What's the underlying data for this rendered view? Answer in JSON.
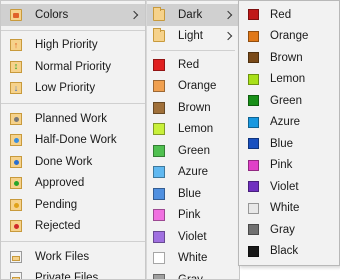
{
  "menu1": {
    "colors_label": "Colors",
    "priorities": [
      {
        "label": "High Priority",
        "icon": "high-priority-icon",
        "glyph": "↑",
        "color": "#e05a1a"
      },
      {
        "label": "Normal Priority",
        "icon": "normal-priority-icon",
        "glyph": "↕",
        "color": "#2aa52a"
      },
      {
        "label": "Low Priority",
        "icon": "low-priority-icon",
        "glyph": "↓",
        "color": "#3a6fd0"
      }
    ],
    "states": [
      {
        "label": "Planned Work",
        "icon": "planned-work-icon",
        "color": "#7a7a7a"
      },
      {
        "label": "Half-Done Work",
        "icon": "half-done-work-icon",
        "color": "#3a8fe0"
      },
      {
        "label": "Done Work",
        "icon": "done-work-icon",
        "color": "#2a6fd0"
      },
      {
        "label": "Approved",
        "icon": "approved-icon",
        "color": "#2aa52a"
      },
      {
        "label": "Pending",
        "icon": "pending-icon",
        "color": "#e0a21a"
      },
      {
        "label": "Rejected",
        "icon": "rejected-icon",
        "color": "#d02a2a"
      }
    ],
    "files": [
      {
        "label": "Work Files",
        "icon": "work-files-icon"
      },
      {
        "label": "Private Files",
        "icon": "private-files-icon"
      }
    ]
  },
  "menu2": {
    "themes": [
      {
        "label": "Dark",
        "icon": "dark-folder-icon"
      },
      {
        "label": "Light",
        "icon": "light-folder-icon"
      }
    ],
    "colors": [
      {
        "label": "Red",
        "color": "#e02020"
      },
      {
        "label": "Orange",
        "color": "#f0a050"
      },
      {
        "label": "Brown",
        "color": "#a0703a"
      },
      {
        "label": "Lemon",
        "color": "#c8f03a"
      },
      {
        "label": "Green",
        "color": "#50c050"
      },
      {
        "label": "Azure",
        "color": "#60b8f0"
      },
      {
        "label": "Blue",
        "color": "#5090e0"
      },
      {
        "label": "Pink",
        "color": "#f070e0"
      },
      {
        "label": "Violet",
        "color": "#a070e0"
      },
      {
        "label": "White",
        "color": "#ffffff"
      },
      {
        "label": "Gray",
        "color": "#a0a0a0"
      }
    ]
  },
  "menu3": {
    "colors": [
      {
        "label": "Red",
        "color": "#c01818"
      },
      {
        "label": "Orange",
        "color": "#e07818"
      },
      {
        "label": "Brown",
        "color": "#7a4a18"
      },
      {
        "label": "Lemon",
        "color": "#a8e018"
      },
      {
        "label": "Green",
        "color": "#189018"
      },
      {
        "label": "Azure",
        "color": "#1898e0"
      },
      {
        "label": "Blue",
        "color": "#1850c0"
      },
      {
        "label": "Pink",
        "color": "#e040c8"
      },
      {
        "label": "Violet",
        "color": "#7030c0"
      },
      {
        "label": "White",
        "color": "#e8e8e8"
      },
      {
        "label": "Gray",
        "color": "#707070"
      },
      {
        "label": "Black",
        "color": "#181818"
      }
    ]
  }
}
